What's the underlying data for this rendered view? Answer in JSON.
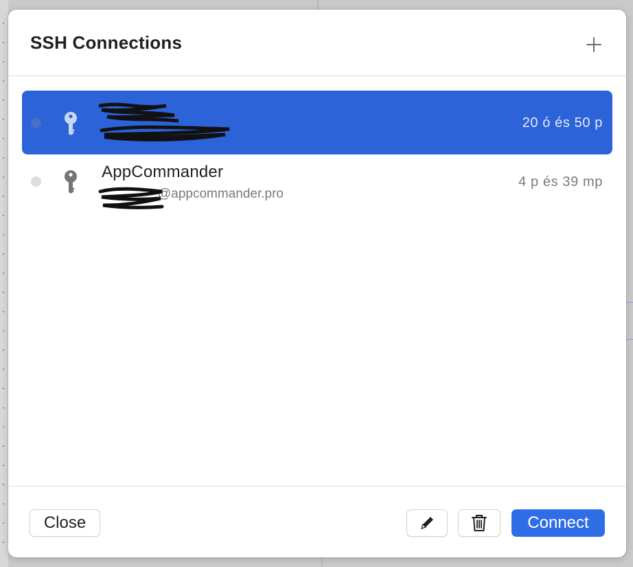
{
  "dialog": {
    "title": "SSH Connections"
  },
  "header": {
    "add_icon": "plus-icon"
  },
  "connections": [
    {
      "name": "",
      "host": "",
      "last_used": "20 ó és 50 p",
      "selected": true
    },
    {
      "name": "AppCommander",
      "host": "@appcommander.pro",
      "last_used": "4 p és 39 mp",
      "selected": false
    }
  ],
  "footer": {
    "close_label": "Close",
    "connect_label": "Connect",
    "edit_icon": "pencil-icon",
    "delete_icon": "trash-icon"
  },
  "colors": {
    "selection": "#2d63d8",
    "primary_button": "#2f6de6"
  }
}
